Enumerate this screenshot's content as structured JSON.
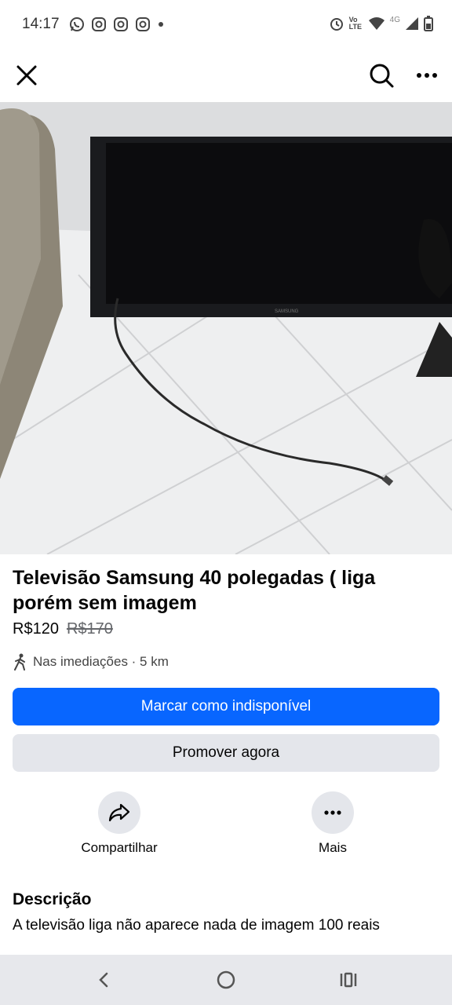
{
  "status_bar": {
    "time": "14:17",
    "network_label": "4G",
    "volte_label": "Vo LTE"
  },
  "app_bar": {
    "close_icon": "close-icon",
    "search_icon": "search-icon",
    "more_icon": "more-horizontal-icon"
  },
  "listing": {
    "title": "Televisão Samsung 40 polegadas ( liga porém sem imagem",
    "price": "R$120",
    "original_price": "R$170",
    "location": "Nas imediações · 5 km",
    "photo_brand_text": "SAMSUNG"
  },
  "buttons": {
    "mark_unavailable": "Marcar como indisponível",
    "promote": "Promover agora"
  },
  "actions": [
    {
      "label": "Compartilhar",
      "icon": "share-icon"
    },
    {
      "label": "Mais",
      "icon": "more-horizontal-icon"
    }
  ],
  "description": {
    "heading": "Descrição",
    "text": "A televisão liga não aparece nada de imagem 100 reais"
  },
  "colors": {
    "primary": "#0866ff",
    "secondary_bg": "#e4e6eb",
    "nav_bg": "#e7e8ec"
  }
}
